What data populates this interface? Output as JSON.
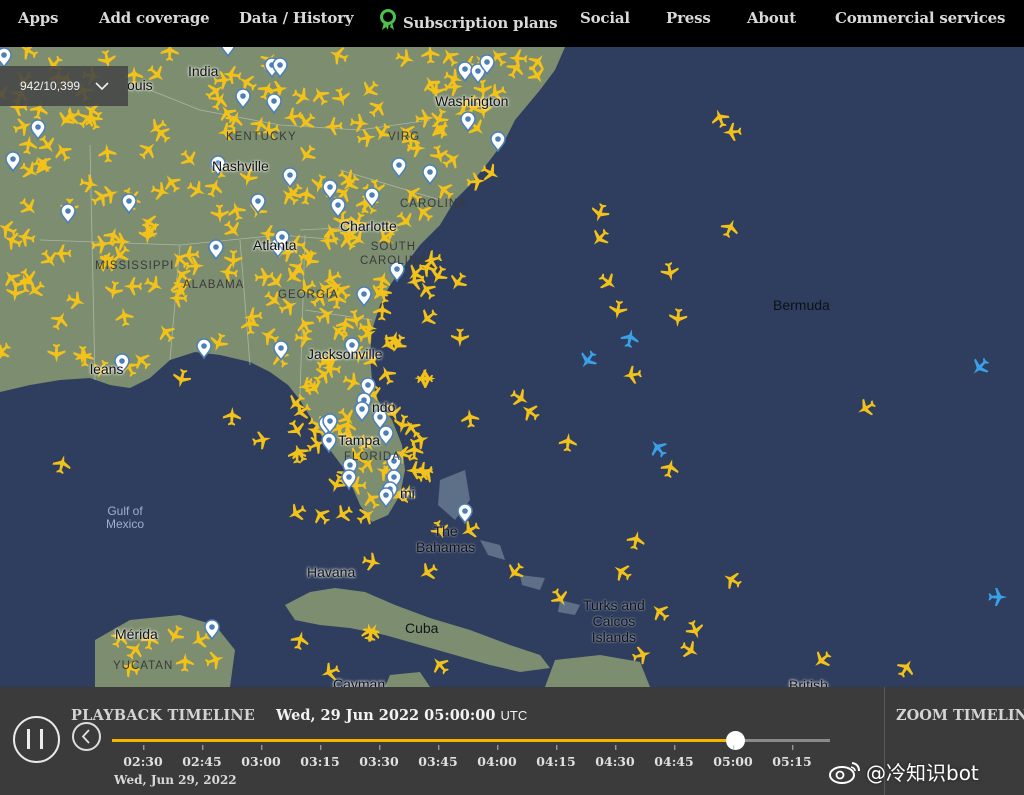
{
  "nav": {
    "apps": "Apps",
    "add_coverage": "Add coverage",
    "data_history": "Data / History",
    "subscription": "Subscription plans",
    "social": "Social",
    "press": "Press",
    "about": "About",
    "commercial": "Commercial services"
  },
  "counter": {
    "text": "942/10,399"
  },
  "map": {
    "labels": {
      "louis": "ouis",
      "indiana": "India",
      "kentucky": "KENTUCKY",
      "virginia": "VIRG",
      "washington": "Washington",
      "nashville": "Nashville",
      "north_carolina": "CAROLINA",
      "charlotte": "Charlotte",
      "south_carolina": "SOUTH\nCAROLINA",
      "atlanta": "Atlanta",
      "mississippi": "MISSISSIPPI",
      "alabama": "ALABAMA",
      "georgia": "GEORGIA",
      "jacksonville": "Jacksonville",
      "orlando": "ndo",
      "tampa": "Tampa",
      "florida": "FLORIDA",
      "miami": "mi",
      "gulf": "Gulf of\nMexico",
      "bahamas": "The\nBahamas",
      "havana": "Havana",
      "cuba": "Cuba",
      "turks": "Turks and\nCaicos\nIslands",
      "bermuda": "Bermuda",
      "merida": "Mérida",
      "yucatan": "YUCATAN",
      "cayman": "Cayman",
      "british": "British",
      "new_orleans": "leans"
    }
  },
  "colors": {
    "ocean": "#2f3e5e",
    "land": "#8a9a7e",
    "aircraft": "#f2c21a",
    "aircraft_selected": "#3aa0e8",
    "timeline_fill": "#f5b400"
  },
  "playback": {
    "title": "PLAYBACK TIMELINE",
    "datetime": "Wed, 29 Jun 2022 05:00:00",
    "tz": "UTC",
    "zoom_title": "ZOOM TIMELINE",
    "date_label": "Wed, Jun 29, 2022",
    "ticks": [
      "02:30",
      "02:45",
      "03:00",
      "03:15",
      "03:30",
      "03:45",
      "04:00",
      "04:15",
      "04:30",
      "04:45",
      "05:00",
      "05:15"
    ],
    "progress": 0.867,
    "pause_icon": "pause-icon",
    "back_icon": "chevron-left-icon"
  },
  "watermark": {
    "text": "@冷知识bot"
  }
}
